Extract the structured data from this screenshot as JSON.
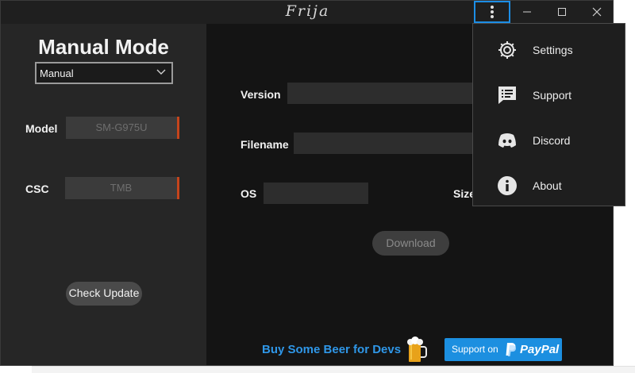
{
  "window": {
    "title": "Frija"
  },
  "titlebar": {
    "menu_icon": "more-vertical-icon",
    "minimize_icon": "minimize-icon",
    "maximize_icon": "maximize-icon",
    "close_icon": "close-icon"
  },
  "left": {
    "mode_title": "Manual Mode",
    "mode_select": {
      "value": "Manual"
    },
    "model": {
      "label": "Model",
      "placeholder": "SM-G975U"
    },
    "csc": {
      "label": "CSC",
      "placeholder": "TMB"
    },
    "check_update_label": "Check Update"
  },
  "main": {
    "version_label": "Version",
    "filename_label": "Filename",
    "os_label": "OS",
    "size_label": "Size",
    "download_label": "Download",
    "beer_text": "Buy Some Beer for Devs",
    "paypal": {
      "prefix": "Support on",
      "brand": "PayPal"
    }
  },
  "menu": {
    "items": [
      {
        "label": "Settings",
        "icon": "gear-icon"
      },
      {
        "label": "Support",
        "icon": "support-chat-icon"
      },
      {
        "label": "Discord",
        "icon": "discord-icon"
      },
      {
        "label": "About",
        "icon": "info-icon"
      }
    ]
  },
  "colors": {
    "accent": "#1c8ee6",
    "field_edge": "#c5441c",
    "link": "#2f97e8"
  }
}
